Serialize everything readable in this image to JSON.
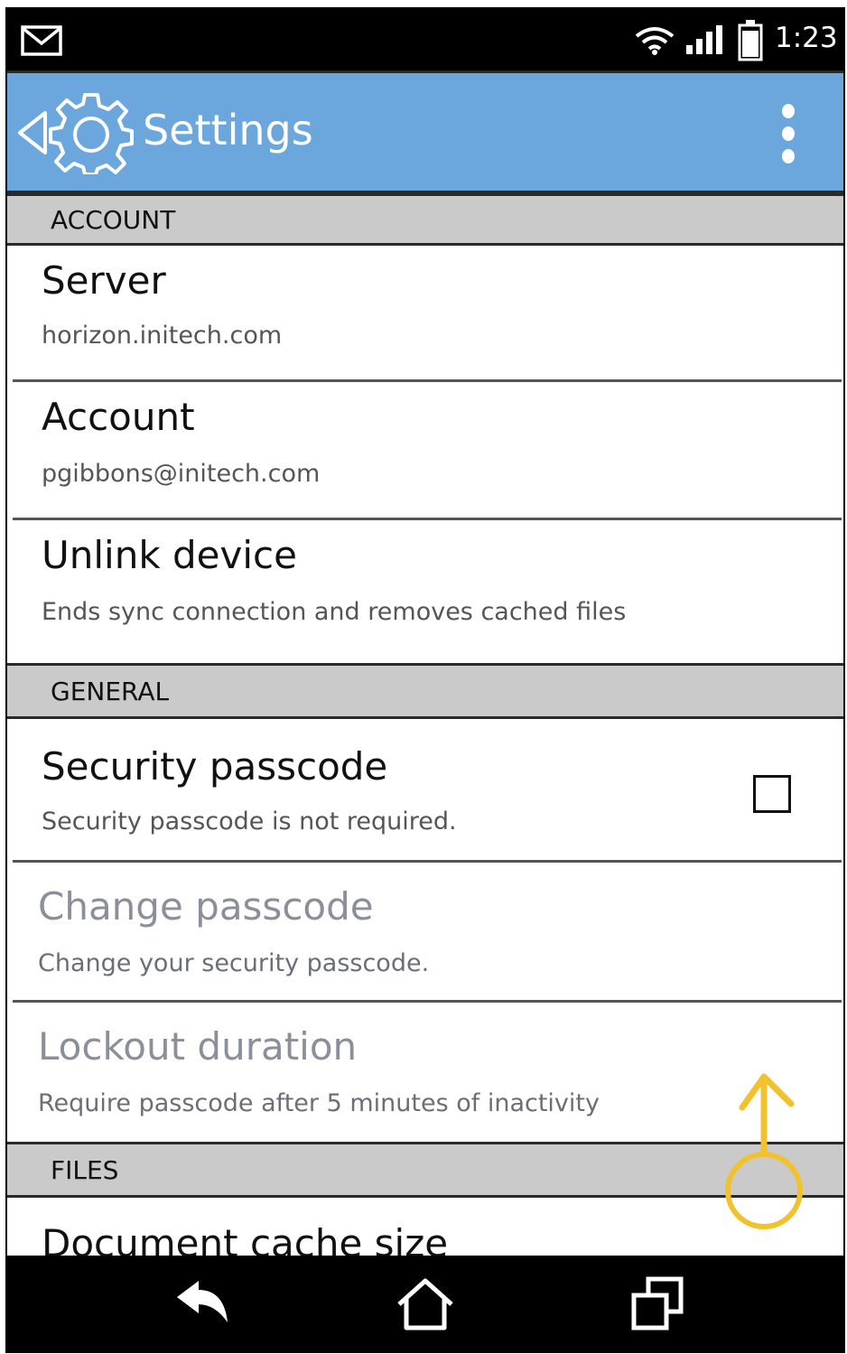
{
  "status_bar": {
    "time": "1:23",
    "icons": [
      "mail-icon",
      "wifi-icon",
      "signal-icon",
      "battery-icon"
    ]
  },
  "app_bar": {
    "title": "Settings",
    "color": "#6ba6dc",
    "icons": [
      "back-icon",
      "gear-icon",
      "overflow-menu-icon"
    ]
  },
  "sections": [
    {
      "header": "ACCOUNT",
      "items": [
        {
          "title": "Server",
          "summary": "horizon.initech.com"
        },
        {
          "title": "Account",
          "summary": "pgibbons@initech.com"
        },
        {
          "title": "Unlink device",
          "summary": "Ends sync connection and removes cached files"
        }
      ]
    },
    {
      "header": "GENERAL",
      "items": [
        {
          "title": "Security passcode",
          "summary": "Security passcode is not required.",
          "checkbox": false
        },
        {
          "title": "Change passcode",
          "summary": "Change your security passcode.",
          "disabled": true
        },
        {
          "title": "Lockout duration",
          "summary": "Require passcode after 5 minutes of inactivity",
          "disabled": true
        }
      ]
    },
    {
      "header": "FILES",
      "items": [
        {
          "title": "Document cache size"
        }
      ]
    }
  ],
  "gesture": {
    "type": "swipe-up",
    "color": "#f2c12e"
  },
  "nav_bar": {
    "icons": [
      "back-nav-icon",
      "home-icon",
      "recents-icon"
    ]
  }
}
